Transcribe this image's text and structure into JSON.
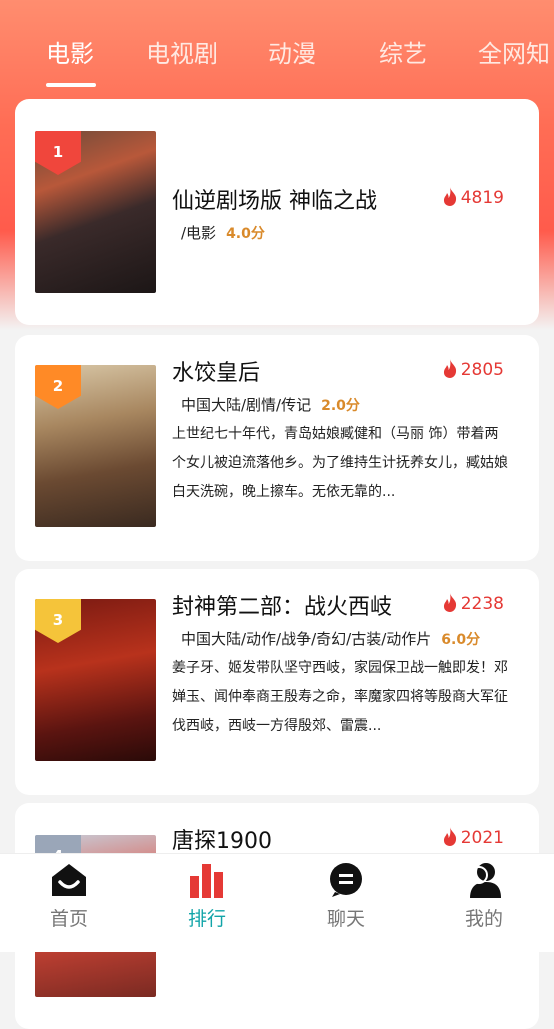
{
  "tabs": [
    "电影",
    "电视剧",
    "动漫",
    "综艺",
    "全网知"
  ],
  "active_tab": "电影",
  "items": [
    {
      "rank": "1",
      "rank_color": "#f0463c",
      "title": "仙逆剧场版 神临之战",
      "tags": "/电影",
      "score": "4.0分",
      "heat": "4819",
      "desc": ""
    },
    {
      "rank": "2",
      "rank_color": "#ff8a26",
      "title": "水饺皇后",
      "tags": "中国大陆/剧情/传记",
      "score": "2.0分",
      "heat": "2805",
      "desc": "上世纪七十年代，青岛姑娘臧健和（马丽 饰）带着两个女儿被迫流落他乡。为了维持生计抚养女儿，臧姑娘白天洗碗，晚上擦车。无依无靠的..."
    },
    {
      "rank": "3",
      "rank_color": "#f5c43a",
      "title": "封神第二部：战火西岐",
      "tags": "中国大陆/动作/战争/奇幻/古装/动作片",
      "score": "6.0分",
      "heat": "2238",
      "desc": "姜子牙、姬发带队坚守西岐，家园保卫战一触即发！邓婵玉、闻仲奉商王殷寿之命，率魔家四将等殷商大军征伐西岐，西岐一方得殷郊、雷震..."
    },
    {
      "rank": "4",
      "rank_color": "#9aa6b8",
      "title": "唐探1900",
      "tags": "",
      "score": "",
      "heat": "2021",
      "desc": ""
    }
  ],
  "nav": [
    {
      "label": "首页",
      "icon": "home-icon"
    },
    {
      "label": "排行",
      "icon": "ranking-icon"
    },
    {
      "label": "聊天",
      "icon": "chat-icon"
    },
    {
      "label": "我的",
      "icon": "user-icon"
    }
  ],
  "active_nav": "排行",
  "colors": {
    "accent_teal": "#11a4a8",
    "heat_red": "#e53935",
    "score_orange": "#d98a2b",
    "hero_top": "#ff8d6f"
  }
}
